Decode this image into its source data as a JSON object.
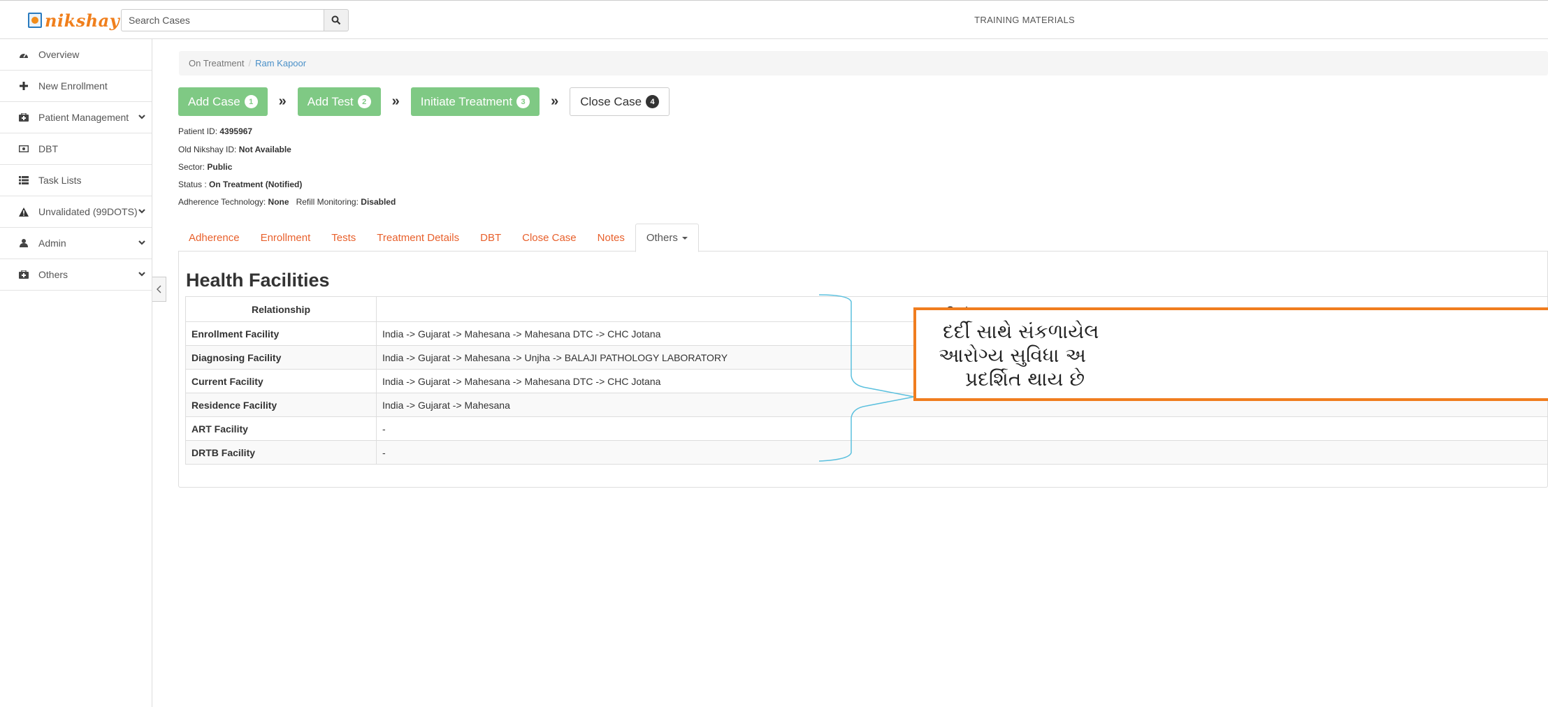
{
  "header": {
    "logo_text": "nikshay",
    "search_placeholder": "Search Cases",
    "training_link": "TRAINING MATERIALS"
  },
  "sidebar": {
    "items": [
      {
        "label": "Overview",
        "icon": "dashboard-icon",
        "chevron": false
      },
      {
        "label": "New Enrollment",
        "icon": "plus-icon",
        "chevron": false
      },
      {
        "label": "Patient Management",
        "icon": "medkit-icon",
        "chevron": true
      },
      {
        "label": "DBT",
        "icon": "money-icon",
        "chevron": false
      },
      {
        "label": "Task Lists",
        "icon": "list-icon",
        "chevron": false
      },
      {
        "label": "Unvalidated (99DOTS)",
        "icon": "warning-icon",
        "chevron": true
      },
      {
        "label": "Admin",
        "icon": "user-icon",
        "chevron": true
      },
      {
        "label": "Others",
        "icon": "medkit-icon",
        "chevron": true
      }
    ]
  },
  "breadcrumb": {
    "parent": "On Treatment",
    "separator": "/",
    "current": "Ram Kapoor"
  },
  "steps": [
    {
      "label": "Add Case",
      "number": "1"
    },
    {
      "label": "Add Test",
      "number": "2"
    },
    {
      "label": "Initiate Treatment",
      "number": "3"
    },
    {
      "label": "Close Case",
      "number": "4"
    }
  ],
  "step_arrow": "»",
  "patient": {
    "id_label": "Patient ID:",
    "id_value": "4395967",
    "old_id_label": "Old Nikshay ID:",
    "old_id_value": "Not Available",
    "sector_label": "Sector:",
    "sector_value": "Public",
    "status_label": "Status :",
    "status_value": "On Treatment (Notified)",
    "adherence_label": "Adherence Technology:",
    "adherence_value": "None",
    "refill_label": "Refill Monitoring:",
    "refill_value": "Disabled"
  },
  "tabs": [
    "Adherence",
    "Enrollment",
    "Tests",
    "Treatment Details",
    "DBT",
    "Close Case",
    "Notes",
    "Others"
  ],
  "section_title": "Health Facilities",
  "table": {
    "headers": [
      "Relationship",
      "Center"
    ],
    "rows": [
      [
        "Enrollment Facility",
        "India -> Gujarat -> Mahesana -> Mahesana DTC -> CHC Jotana"
      ],
      [
        "Diagnosing Facility",
        "India -> Gujarat -> Mahesana -> Unjha -> BALAJI PATHOLOGY LABORATORY"
      ],
      [
        "Current Facility",
        "India -> Gujarat -> Mahesana -> Mahesana DTC -> CHC Jotana"
      ],
      [
        "Residence Facility",
        "India -> Gujarat -> Mahesana"
      ],
      [
        "ART Facility",
        "-"
      ],
      [
        "DRTB Facility",
        "-"
      ]
    ]
  },
  "callout": {
    "lines": [
      "દર્દી સાથે સંકળાયેલ",
      "આરોગ્ય સુવિધા અ",
      "પ્રદર્શિત થાય છે"
    ]
  },
  "colors": {
    "accent_orange": "#e8602c",
    "step_green": "#7fc984",
    "link_blue": "#4a90c8",
    "callout_border": "#f07d1f",
    "brace_blue": "#5bc0de"
  }
}
